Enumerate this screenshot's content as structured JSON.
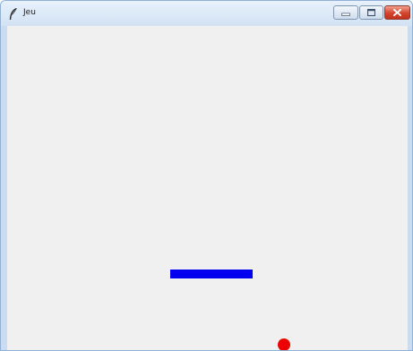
{
  "window": {
    "title": "Jeu",
    "app_icon": "feather-icon",
    "controls": {
      "minimize_icon": "minimize-icon",
      "maximize_icon": "maximize-icon",
      "close_icon": "close-icon"
    }
  },
  "game": {
    "paddle": {
      "color": "#0000ee"
    },
    "ball": {
      "color": "#ee0000"
    },
    "background": "#f0f0f0"
  }
}
